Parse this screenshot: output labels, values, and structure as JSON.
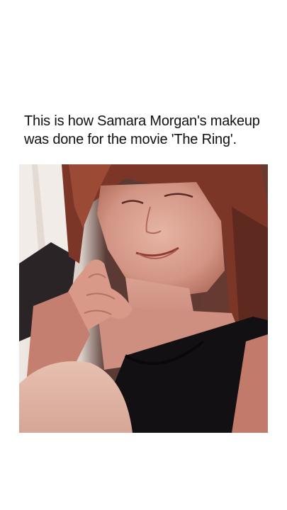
{
  "post": {
    "caption_line_1": "This is how Samara Morgan's makeup",
    "caption_line_2": "was done for the movie 'The Ring'."
  },
  "media": {
    "type": "video-frame",
    "description_icon": "video-still"
  },
  "colors": {
    "background": "#ffffff",
    "text": "#111111",
    "hair": "#8a3a2a",
    "skin": "#d79d8c",
    "shirt": "#121012",
    "backdrop": "#e9e2dc"
  }
}
